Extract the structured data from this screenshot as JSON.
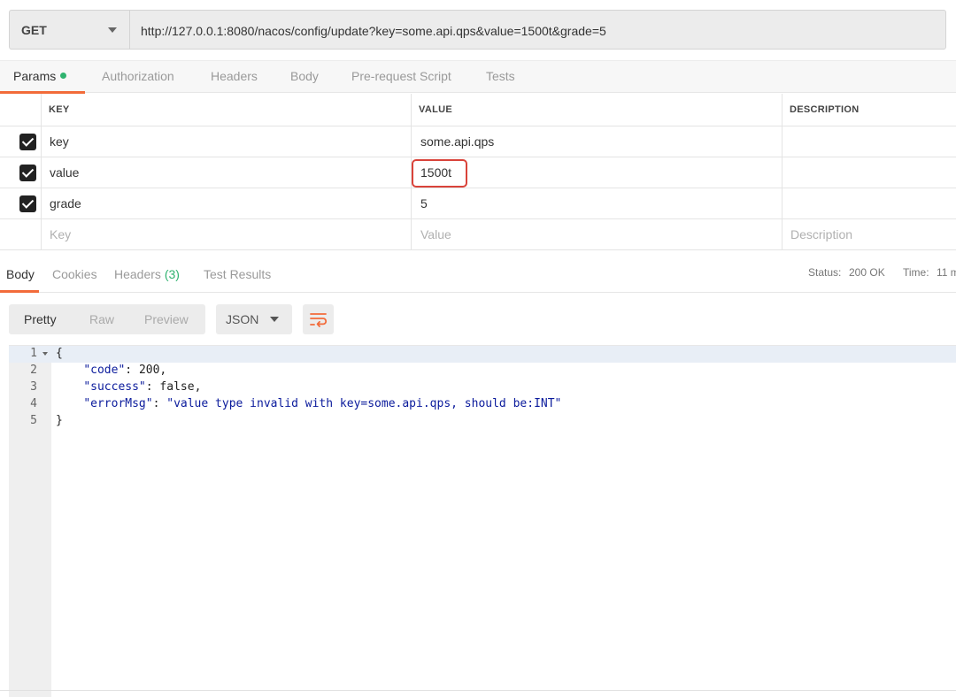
{
  "request": {
    "method": "GET",
    "url": "http://127.0.0.1:8080/nacos/config/update?key=some.api.qps&value=1500t&grade=5"
  },
  "request_tabs": [
    {
      "label": "Params",
      "active": true,
      "dot_color": "#2fb36f"
    },
    {
      "label": "Authorization",
      "active": false
    },
    {
      "label": "Headers",
      "active": false
    },
    {
      "label": "Body",
      "active": false
    },
    {
      "label": "Pre-request Script",
      "active": false
    },
    {
      "label": "Tests",
      "active": false
    }
  ],
  "params_table": {
    "headers": [
      "KEY",
      "VALUE",
      "DESCRIPTION"
    ],
    "rows": [
      {
        "checked": true,
        "key": "key",
        "value": "some.api.qps",
        "description": ""
      },
      {
        "checked": true,
        "key": "value",
        "value": "1500t",
        "description": "",
        "highlighted": true
      },
      {
        "checked": true,
        "key": "grade",
        "value": "5",
        "description": ""
      }
    ],
    "placeholders": {
      "key": "Key",
      "value": "Value",
      "description": "Description"
    }
  },
  "response_tabs": [
    {
      "label": "Body",
      "active": true
    },
    {
      "label": "Cookies",
      "active": false
    },
    {
      "label": "Headers",
      "count": "(3)",
      "active": false
    },
    {
      "label": "Test Results",
      "active": false
    }
  ],
  "status": {
    "label": "Status:",
    "value": "200 OK",
    "time_label": "Time:",
    "time_value": "11 m"
  },
  "viewer": {
    "modes": [
      "Pretty",
      "Raw",
      "Preview"
    ],
    "active_mode": "Pretty",
    "format": "JSON"
  },
  "code_lines": [
    {
      "num": "1",
      "text": "{"
    },
    {
      "num": "2",
      "key": "\"code\"",
      "sep": ": ",
      "val": "200",
      "tail": ","
    },
    {
      "num": "3",
      "key": "\"success\"",
      "sep": ": ",
      "val": "false",
      "tail": ","
    },
    {
      "num": "4",
      "key": "\"errorMsg\"",
      "sep": ": ",
      "val": "\"value type invalid with key=some.api.qps, should be:INT\"",
      "tail": ""
    },
    {
      "num": "5",
      "text": "}"
    }
  ],
  "colors": {
    "accent": "#f26b3a",
    "success": "#2fb36f",
    "highlight_border": "#d9433a",
    "json_key": "#0b1b9c"
  }
}
